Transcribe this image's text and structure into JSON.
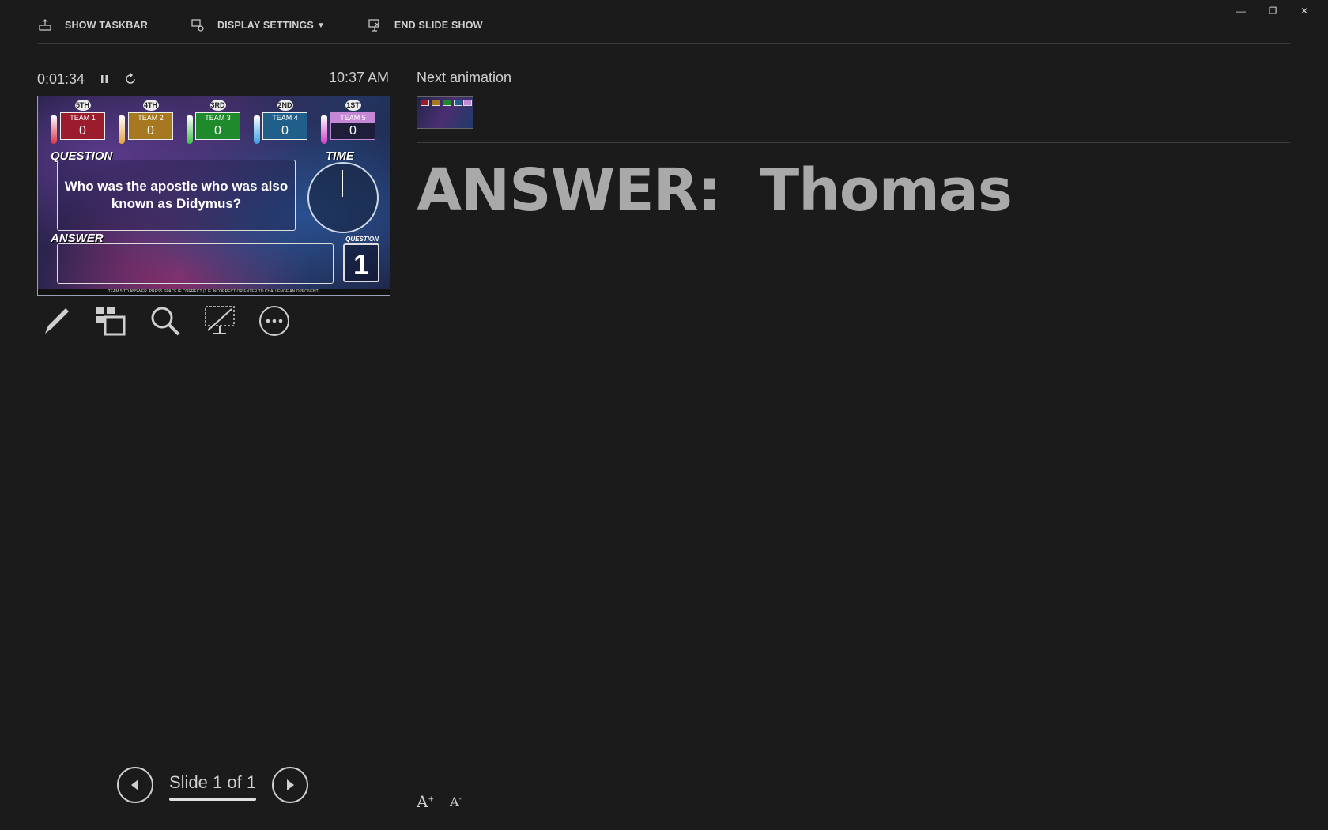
{
  "toolbar": {
    "show_taskbar": "SHOW TASKBAR",
    "display_settings": "DISPLAY SETTINGS",
    "end_slide_show": "END SLIDE SHOW"
  },
  "window_controls": [
    "minimize-icon",
    "restore-icon",
    "close-icon"
  ],
  "timer": {
    "elapsed": "0:01:34",
    "clock": "10:37 AM"
  },
  "current_slide": {
    "teams": [
      {
        "rank": "5TH",
        "name": "TEAM 1",
        "score": "0",
        "color": "#9b1c2c"
      },
      {
        "rank": "4TH",
        "name": "TEAM 2",
        "score": "0",
        "color": "#a6781f"
      },
      {
        "rank": "3RD",
        "name": "TEAM 3",
        "score": "0",
        "color": "#1f8a2c"
      },
      {
        "rank": "2ND",
        "name": "TEAM 4",
        "score": "0",
        "color": "#1f5f8a"
      },
      {
        "rank": "1ST",
        "name": "TEAM 5",
        "score": "0",
        "color": "#c488d6"
      }
    ],
    "question_label": "QUESTION",
    "question_text": "Who was the apostle who was also known as Didymus?",
    "time_label": "TIME",
    "answer_label": "ANSWER",
    "question_number_label": "QUESTION",
    "question_number": "1",
    "footer_text": "TEAM 5 TO ANSWER. PRESS SPACE IF CORRECT (1 IF INCORRECT OR ENTER TO CHALLENGE AN OPPONENT)"
  },
  "tools": [
    "pen-icon",
    "see-all-slides-icon",
    "zoom-icon",
    "black-screen-icon",
    "more-options-icon"
  ],
  "next": {
    "label": "Next animation"
  },
  "notes": {
    "text": "ANSWER:  Thomas"
  },
  "navigation": {
    "counter": "Slide 1 of 1"
  },
  "font_controls": [
    "increase-font-icon",
    "decrease-font-icon"
  ]
}
